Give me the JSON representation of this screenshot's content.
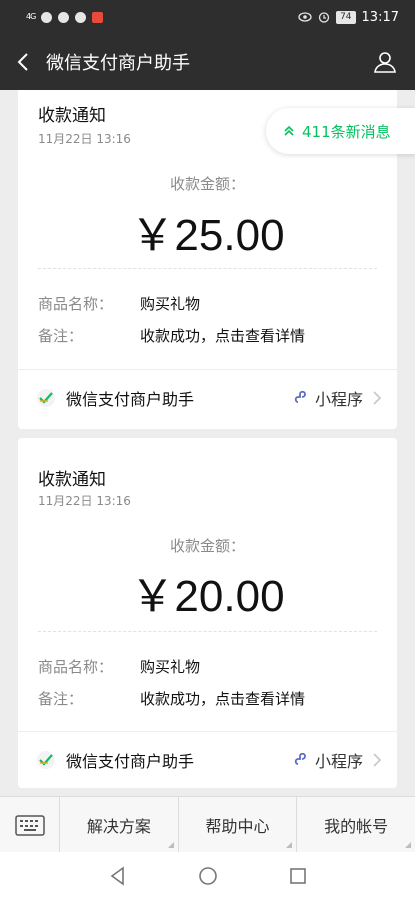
{
  "status_bar": {
    "signal": "4G",
    "battery": "74",
    "time": "13:17"
  },
  "nav": {
    "title": "微信支付商户助手"
  },
  "new_messages": {
    "label": "411条新消息"
  },
  "cards": [
    {
      "title": "收款通知",
      "time": "11月22日  13:16",
      "amount_label": "收款金额：",
      "amount": "￥25.00",
      "product_key": "商品名称：",
      "product_value": "购买礼物",
      "note_key": "备注：",
      "note_value": "收款成功，点击查看详情",
      "footer_name": "微信支付商户助手",
      "mini_program": "小程序"
    },
    {
      "title": "收款通知",
      "time": "11月22日  13:16",
      "amount_label": "收款金额：",
      "amount": "￥20.00",
      "product_key": "商品名称：",
      "product_value": "购买礼物",
      "note_key": "备注：",
      "note_value": "收款成功，点击查看详情",
      "footer_name": "微信支付商户助手",
      "mini_program": "小程序"
    }
  ],
  "bottom_menu": {
    "items": [
      "解决方案",
      "帮助中心",
      "我的帐号"
    ]
  },
  "colors": {
    "accent": "#07c160",
    "header": "#2e2e2e",
    "background": "#ededed"
  }
}
